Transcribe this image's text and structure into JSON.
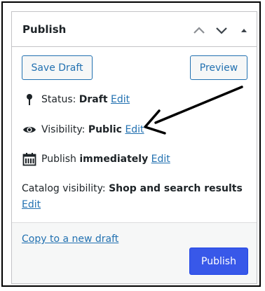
{
  "panel": {
    "title": "Publish",
    "header_icons": [
      "chevron-up-icon",
      "chevron-down-icon",
      "caret-up-icon"
    ]
  },
  "actions": {
    "save_draft": "Save Draft",
    "preview": "Preview"
  },
  "status": {
    "label": "Status:",
    "value": "Draft",
    "edit": "Edit"
  },
  "visibility": {
    "label": "Visibility:",
    "value": "Public",
    "edit": "Edit"
  },
  "schedule": {
    "label": "Publish",
    "value": "immediately",
    "edit": "Edit"
  },
  "catalog": {
    "label": "Catalog visibility:",
    "value": "Shop and search results",
    "edit": "Edit"
  },
  "footer": {
    "copy_link": "Copy to a new draft",
    "publish": "Publish"
  },
  "colors": {
    "link": "#2271b1",
    "primary": "#3858e9",
    "border": "#c3c4c7"
  }
}
